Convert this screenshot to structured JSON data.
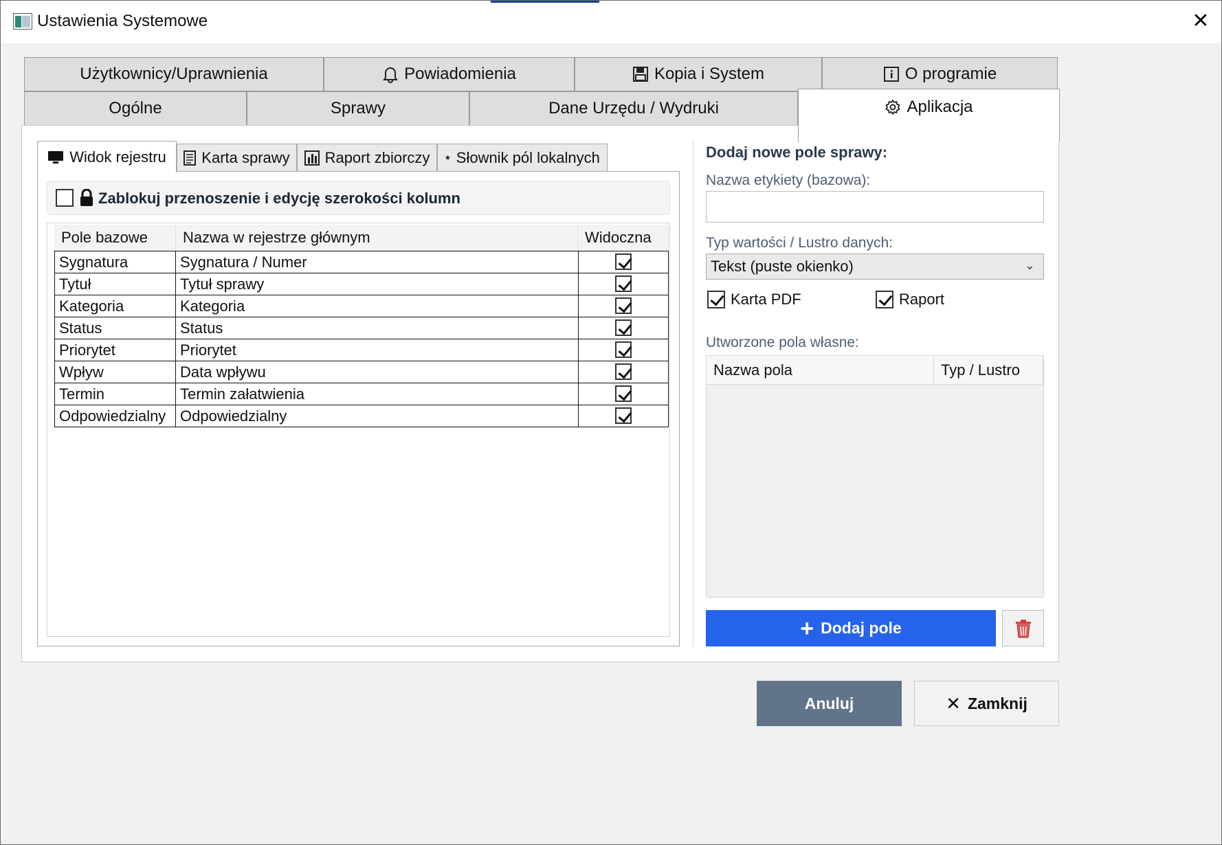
{
  "window": {
    "title": "Ustawienia Systemowe",
    "close_glyph": "✕"
  },
  "tabs_row1": [
    {
      "label": "Użytkownicy/Uprawnienia",
      "icon": ""
    },
    {
      "label": "Powiadomienia",
      "icon": "bell-icon"
    },
    {
      "label": "Kopia i System",
      "icon": "floppy-disk-icon"
    },
    {
      "label": "O programie",
      "icon": "info-icon"
    }
  ],
  "tabs_row2": [
    {
      "label": "Ogólne"
    },
    {
      "label": "Sprawy"
    },
    {
      "label": "Dane Urzędu / Wydruki"
    },
    {
      "label": "Aplikacja",
      "icon": "gear-icon",
      "active": true
    }
  ],
  "subtabs": [
    {
      "label": "Widok rejestru",
      "icon": "monitor-icon",
      "active": true
    },
    {
      "label": "Karta sprawy",
      "icon": "document-icon"
    },
    {
      "label": "Raport zbiorczy",
      "icon": "bar-chart-icon"
    },
    {
      "label": "Słownik pól lokalnych",
      "icon": "star-icon",
      "glyph": "⭑"
    }
  ],
  "lock_columns": {
    "label": "Zablokuj przenoszenie i edycję szerokości kolumn",
    "checked": false
  },
  "fields_table": {
    "headers": [
      "Pole bazowe",
      "Nazwa w rejestrze głównym",
      "Widoczna"
    ],
    "rows": [
      {
        "base": "Sygnatura",
        "name": "Sygnatura / Numer",
        "visible": true
      },
      {
        "base": "Tytuł",
        "name": "Tytuł sprawy",
        "visible": true
      },
      {
        "base": "Kategoria",
        "name": "Kategoria",
        "visible": true
      },
      {
        "base": "Status",
        "name": "Status",
        "visible": true
      },
      {
        "base": "Priorytet",
        "name": "Priorytet",
        "visible": true
      },
      {
        "base": "Wpływ",
        "name": "Data wpływu",
        "visible": true
      },
      {
        "base": "Termin",
        "name": "Termin załatwienia",
        "visible": true
      },
      {
        "base": "Odpowiedzialny",
        "name": "Odpowiedzialny",
        "visible": true
      }
    ]
  },
  "new_field": {
    "heading": "Dodaj nowe pole sprawy:",
    "label_caption": "Nazwa etykiety (bazowa):",
    "label_value": "",
    "type_caption": "Typ wartości / Lustro danych:",
    "type_value": "Tekst (puste okienko)",
    "karta_pdf": {
      "label": "Karta PDF",
      "checked": true
    },
    "raport": {
      "label": "Raport",
      "checked": true
    },
    "own_caption": "Utworzone pola własne:",
    "own_headers": [
      "Nazwa pola",
      "Typ / Lustro"
    ],
    "add_label": "Dodaj pole",
    "add_glyph": "+"
  },
  "footer": {
    "cancel_label": "Anuluj",
    "close_label": "Zamknij",
    "close_glyph": "✕"
  },
  "colors": {
    "accent_blue": "#2563eb",
    "cancel_gray": "#627489",
    "trash_red": "#d63b3b"
  }
}
